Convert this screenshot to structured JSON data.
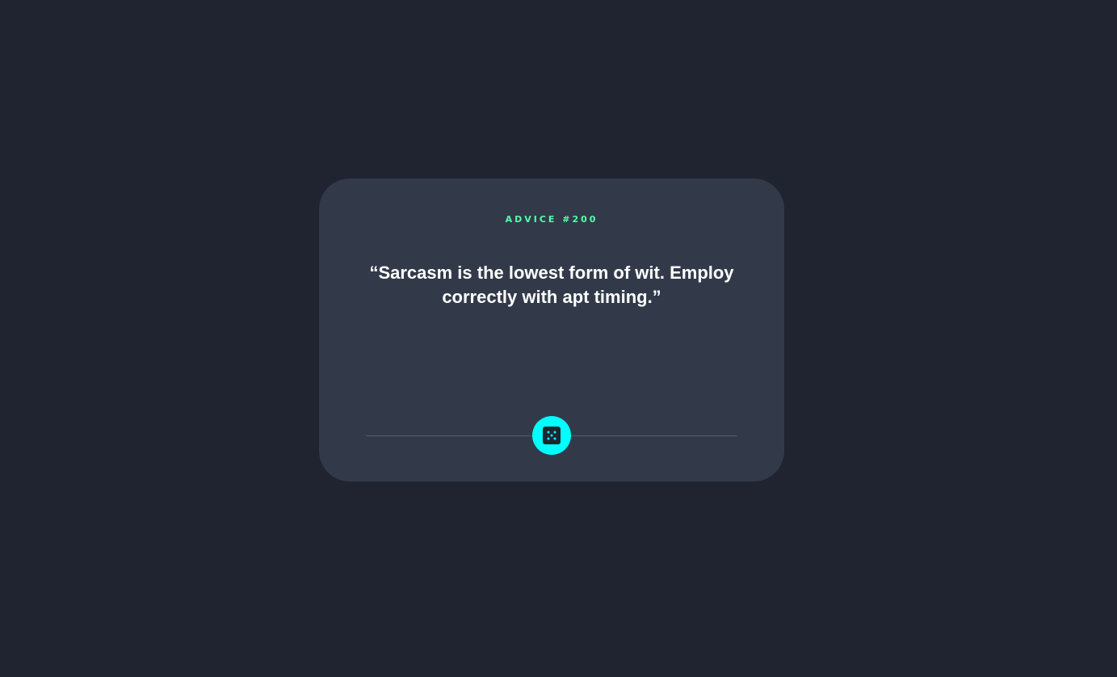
{
  "advice": {
    "label": "ADVICE #200",
    "text": "“Sarcasm is the lowest form of wit. Employ correctly with apt timing.”"
  },
  "controls": {
    "dice_icon": "dice-icon"
  },
  "colors": {
    "background": "#1f2430",
    "card": "#323a4a",
    "accent_green": "#53ffaa",
    "accent_cyan": "#00ffff",
    "text": "#ffffff",
    "divider": "#4e5d73"
  }
}
